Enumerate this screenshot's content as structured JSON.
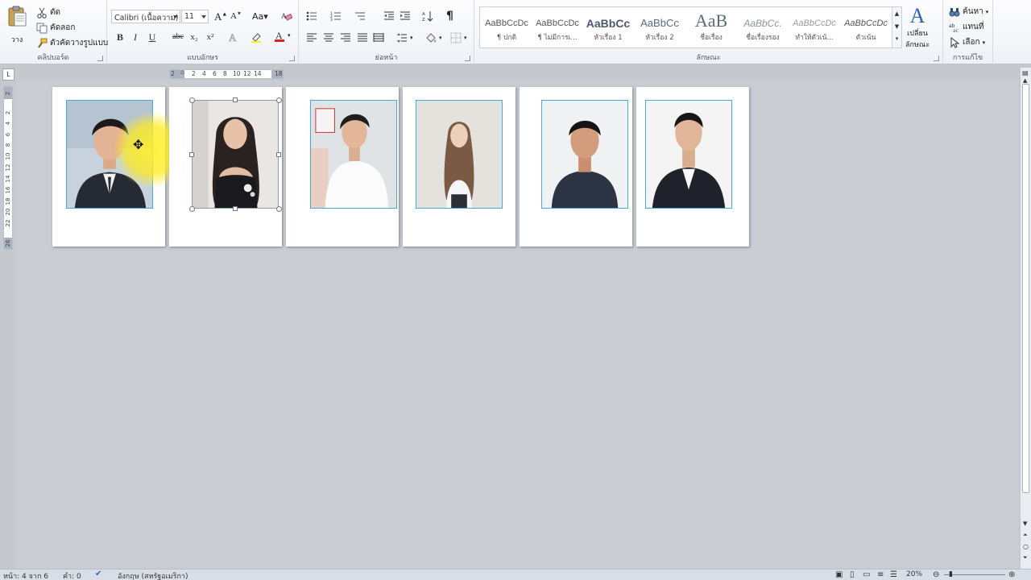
{
  "ribbon": {
    "clipboard": {
      "paste_label": "วาง",
      "cut_label": "ตัด",
      "copy_label": "คัดลอก",
      "format_painter_label": "ตัวคัดวางรูปแบบ",
      "group_label": "คลิปบอร์ด"
    },
    "font": {
      "font_name": "Calibri (เนื้อความ)",
      "font_size": "11",
      "group_label": "แบบอักษร",
      "bold": "B",
      "italic": "I",
      "underline": "U",
      "strike": "abc",
      "subscript": "x₂",
      "superscript": "x²",
      "font_color": "#e02020",
      "highlight_color": "#f7f21c"
    },
    "paragraph": {
      "group_label": "ย่อหน้า",
      "show_marks": "¶"
    },
    "styles": {
      "group_label": "ลักษณะ",
      "items": [
        {
          "sample": "AaBbCcDc",
          "name": "¶ ปกติ"
        },
        {
          "sample": "AaBbCcDc",
          "name": "¶ ไม่มีการเ..."
        },
        {
          "sample": "AaBbCc",
          "name": "หัวเรื่อง 1"
        },
        {
          "sample": "AaBbCc",
          "name": "หัวเรื่อง 2"
        },
        {
          "sample": "AaB",
          "name": "ชื่อเรื่อง"
        },
        {
          "sample": "AaBbCc.",
          "name": "ชื่อเรื่องรอง"
        },
        {
          "sample": "AaBbCcDc",
          "name": "ทำให้ตัวเน้...",
          "note": ""
        },
        {
          "sample": "AaBbCcDc",
          "name": "ตัวเน้น"
        }
      ],
      "change_styles_label_1": "เปลี่ยน",
      "change_styles_label_2": "ลักษณะ"
    },
    "editing": {
      "group_label": "การแก้ไข",
      "find_label": "ค้นหา",
      "replace_label": "แทนที่",
      "select_label": "เลือก"
    }
  },
  "ruler": {
    "horizontal_ticks": [
      "2",
      "2",
      "4",
      "6",
      "8",
      "10",
      "12",
      "14",
      "18"
    ],
    "vertical_ticks": [
      "2",
      "2",
      "4",
      "6",
      "8",
      "10",
      "12",
      "14",
      "16",
      "18",
      "20",
      "22",
      "26"
    ],
    "corner": "L"
  },
  "document": {
    "page_count": 6,
    "selected_photo_index": 1
  },
  "status_bar": {
    "page_info": "หน้า: 4 จาก 6",
    "word_count": "คำ: 0",
    "language": "อังกฤษ (สหรัฐอเมริกา)",
    "zoom": "20%"
  }
}
